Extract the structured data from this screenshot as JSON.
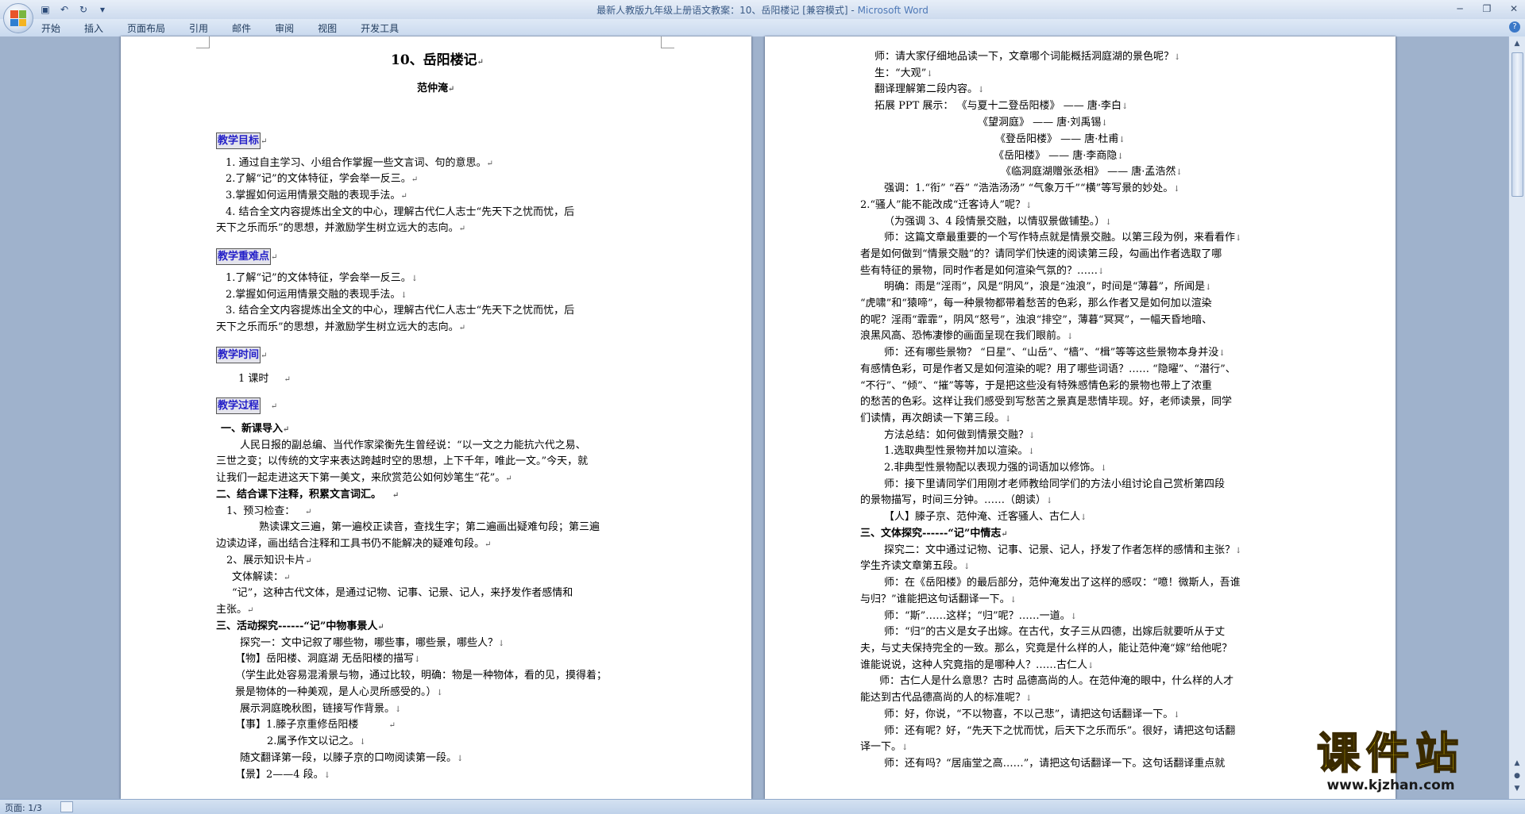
{
  "window": {
    "title_doc": "最新人教版九年级上册语文教案：10、岳阳楼记 [兼容模式] - ",
    "title_app": "Microsoft Word"
  },
  "ribbon": {
    "tabs": [
      "开始",
      "插入",
      "页面布局",
      "引用",
      "邮件",
      "审阅",
      "视图",
      "开发工具"
    ]
  },
  "status": {
    "page": "页面: 1/3"
  },
  "watermark": {
    "text": "课件站",
    "url": "www.kjzhan.com"
  },
  "page1": {
    "title": "10、岳阳楼记",
    "author": "范仲淹",
    "h_goals": "教学目标",
    "goals": [
      "1. 通过自主学习、小组合作掌握一些文言词、句的意思。",
      "2.了解“记”的文体特征，学会举一反三。",
      "3.掌握如何运用情景交融的表现手法。",
      "4. 结合全文内容提炼出全文的中心，理解古代仁人志士“先天下之忧而忧，后",
      "天下之乐而乐”的思想，并激励学生树立远大的志向。"
    ],
    "h_keys": "教学重难点",
    "keys": [
      "1.了解“记”的文体特征，学会举一反三。",
      "2.掌握如何运用情景交融的表现手法。",
      "3. 结合全文内容提炼出全文的中心，理解古代仁人志士“先天下之忧而忧，后",
      "天下之乐而乐”的思想，并激励学生树立远大的志向。"
    ],
    "h_time": "教学时间",
    "time": "1 课时",
    "h_process": "教学过程",
    "process": [
      "一、新课导入",
      "人民日报的副总编、当代作家梁衡先生曾经说：“以一文之力能抗六代之易、",
      "三世之变；以传统的文字来表达跨越时空的思想，上下千年，唯此一文。”今天，就",
      "让我们一起走进这天下第一美文，来欣赏范公如何妙笔生“花”。",
      "二、结合课下注释，积累文言词汇。",
      "1、预习检查：",
      "熟读课文三遍，第一遍校正读音，查找生字；第二遍画出疑难句段；第三遍",
      "边读边译，画出结合注释和工具书仍不能解决的疑难句段。",
      "2、展示知识卡片",
      "文体解读：",
      "“记”，这种古代文体，是通过记物、记事、记景、记人，来抒发作者感情和",
      "主张。",
      "三、活动探究------“记”中物事景人",
      "探究一：文中记叙了哪些物，哪些事，哪些景，哪些人？",
      "【物】岳阳楼、洞庭湖          无岳阳楼的描写",
      "（学生此处容易混淆景与物，通过比较，明确：物是一种物体，看的见，摸得着；",
      "景是物体的一种美观，是人心灵所感受的。）",
      "展示洞庭晚秋图，链接写作背景。",
      "【事】1.滕子京重修岳阳楼",
      "2.属予作文以记之。",
      "随文翻译第一段，以滕子京的口吻阅读第一段。",
      "【景】2——4 段。"
    ]
  },
  "page2": {
    "lines": [
      "师：请大家仔细地品读一下，文章哪个词能概括洞庭湖的景色呢？",
      "生：“大观”",
      "翻译理解第二段内容。",
      "拓展 PPT 展示：        《与夏十二登岳阳楼》    —— 唐·李白",
      "《望洞庭》    —— 唐·刘禹锡",
      "《登岳阳楼》    —— 唐·杜甫",
      "《岳阳楼》 —— 唐·李商隐",
      "《临洞庭湖赠张丞相》 —— 唐·孟浩然",
      "强调：1.“衔” “吞” “浩浩汤汤” “气象万千”“横”等写景的妙处。",
      "2.“骚人”能不能改成“迁客诗人”呢？",
      "（为强调 3、4 段情景交融，以情驭景做铺垫。）",
      "师：这篇文章最重要的一个写作特点就是情景交融。以第三段为例，来看看作",
      "者是如何做到“情景交融”的？请同学们快速的阅读第三段，勾画出作者选取了哪",
      "些有特征的景物，同时作者是如何渲染气氛的？……",
      "明确：雨是“淫雨”，风是“阴风”，浪是“浊浪”，时间是“薄暮”，所闻是",
      "“虎啸”和“猿啼”，每一种景物都带着愁苦的色彩，那么作者又是如何加以渲染",
      "的呢？淫雨“霏霏”，阴风“怒号”，浊浪“排空”，薄暮“冥冥”，一幅天昏地暗、",
      "浪黑风高、恐怖凄惨的画面呈现在我们眼前。",
      "师：还有哪些景物？ “日星”、“山岳”、“樯”、“楫”等等这些景物本身并没",
      "有感情色彩，可是作者又是如何渲染的呢？用了哪些词语？…… “隐曜”、“潜行”、",
      "“不行”、“倾”、“摧”等等，于是把这些没有特殊感情色彩的景物也带上了浓重",
      "的愁苦的色彩。这样让我们感受到写愁苦之景真是悲情毕现。好，老师读景，同学",
      "们读情，再次朗读一下第三段。",
      "方法总结：如何做到情景交融？",
      "1.选取典型性景物并加以渲染。",
      "2.非典型性景物配以表现力强的词语加以修饰。",
      "师：接下里请同学们用刚才老师教给同学们的方法小组讨论自己赏析第四段",
      "的景物描写，时间三分钟。……（朗读）",
      "【人】滕子京、范仲淹、迁客骚人、古仁人",
      "三、文体探究------“记”中情志",
      "探究二：文中通过记物、记事、记景、记人，抒发了作者怎样的感情和主张？",
      "学生齐读文章第五段。",
      "师：在《岳阳楼》的最后部分，范仲淹发出了这样的感叹：“噫！微斯人，吾谁",
      "与归？”谁能把这句话翻译一下。",
      "师：“斯”……这样；“归”呢？……一道。",
      "师：“归”的古义是女子出嫁。在古代，女子三从四德，出嫁后就要听从于丈",
      "夫，与丈夫保持完全的一致。那么，究竟是什么样的人，能让范仲淹“嫁”给他呢？",
      "谁能说说，这种人究竟指的是哪种人？……古仁人",
      "师：古仁人是什么意思？古时 品德高尚的人。在范仲淹的眼中，什么样的人才",
      "能达到古代品德高尚的人的标准呢？",
      "师：好，你说，“不以物喜，不以己悲”，请把这句话翻译一下。",
      "师：还有呢？好，“先天下之忧而忧，后天下之乐而乐”。很好，请把这句话翻",
      "译一下。",
      "师：还有吗？“居庙堂之高……”，请把这句话翻译一下。这句话翻译重点就"
    ]
  }
}
